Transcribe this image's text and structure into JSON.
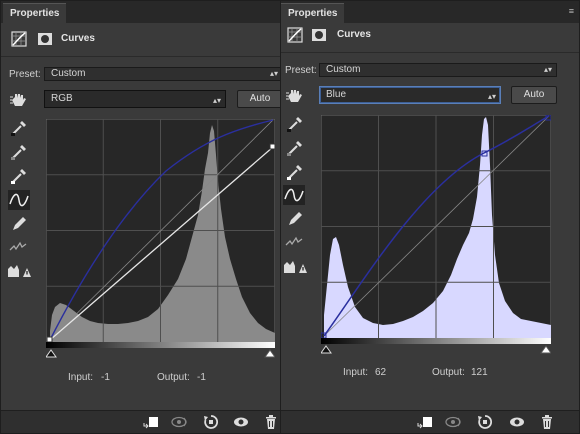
{
  "left_panel": {
    "tab": "Properties",
    "title": "Curves",
    "preset_label": "Preset:",
    "preset_value": "Custom",
    "channel": "RGB",
    "auto_label": "Auto",
    "input_label": "Input:",
    "input_value": "-1",
    "output_label": "Output:",
    "output_value": "-1"
  },
  "right_panel": {
    "tab": "Properties",
    "title": "Curves",
    "preset_label": "Preset:",
    "preset_value": "Custom",
    "channel": "Blue",
    "auto_label": "Auto",
    "input_label": "Input:",
    "input_value": "62",
    "output_label": "Output:",
    "output_value": "121"
  },
  "colors": {
    "panel_bg": "#3a3a3a",
    "graph_bg": "#272727",
    "histogram_rgb": "#8a8a8a",
    "histogram_blue": "#d8d8ff",
    "curve_blue": "#2a2f9e",
    "focus_border": "#5a7fb8"
  },
  "icons": [
    "curves-adjustment-icon",
    "layer-mask-icon",
    "on-image-adjust-icon",
    "black-point-eyedropper-icon",
    "gray-point-eyedropper-icon",
    "white-point-eyedropper-icon",
    "curve-points-icon",
    "pencil-icon",
    "smooth-icon",
    "clipping-warning-icon",
    "clip-to-layer-icon",
    "view-previous-state-icon",
    "reset-icon",
    "visibility-eye-icon",
    "delete-icon"
  ]
}
